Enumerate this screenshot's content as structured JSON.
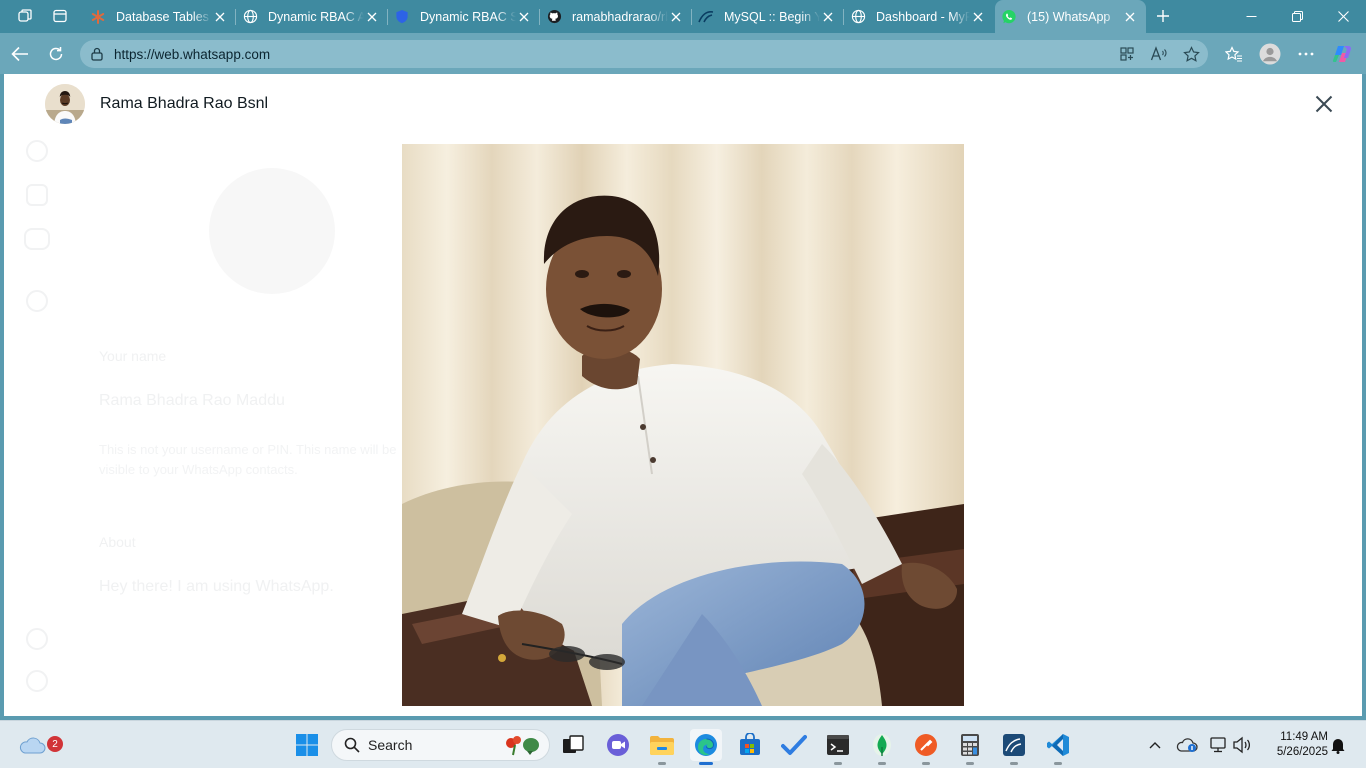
{
  "browser": {
    "tabs": [
      {
        "title": "Database Tables and",
        "icon": "asterisk-icon"
      },
      {
        "title": "Dynamic RBAC Admin",
        "icon": "globe-icon"
      },
      {
        "title": "Dynamic RBAC System",
        "icon": "shield-icon"
      },
      {
        "title": "ramabhadrarao/rbac",
        "icon": "github-icon"
      },
      {
        "title": "MySQL :: Begin Your",
        "icon": "mysql-icon"
      },
      {
        "title": "Dashboard - MyRBAC",
        "icon": "globe-icon"
      },
      {
        "title": "(15) WhatsApp",
        "icon": "whatsapp-icon",
        "active": true
      }
    ],
    "address": {
      "url": "https://web.whatsapp.com"
    },
    "colors": {
      "tabstrip": "#3f8aa0",
      "toolbar": "#6ba7ba"
    }
  },
  "viewer": {
    "contact_name": "Rama Bhadra Rao Bsnl",
    "close_label": "Close"
  },
  "background_profile": {
    "name_label": "Your name",
    "name_value": "Rama Bhadra Rao Maddu",
    "name_help": "This is not your username or PIN. This name will be visible to your WhatsApp contacts.",
    "about_label": "About",
    "about_value": "Hey there! I am using WhatsApp."
  },
  "taskbar": {
    "search_placeholder": "Search",
    "weather_badge": "2",
    "clock_time": "11:49 AM",
    "clock_date": "5/26/2025",
    "apps": [
      "start-icon",
      "search",
      "task-view-icon",
      "teams-chat-icon",
      "file-explorer-icon",
      "edge-icon",
      "store-icon",
      "todo-icon",
      "terminal-icon",
      "mongodb-compass-icon",
      "postman-icon",
      "calculator-icon",
      "mysql-workbench-icon",
      "vscode-icon"
    ]
  }
}
